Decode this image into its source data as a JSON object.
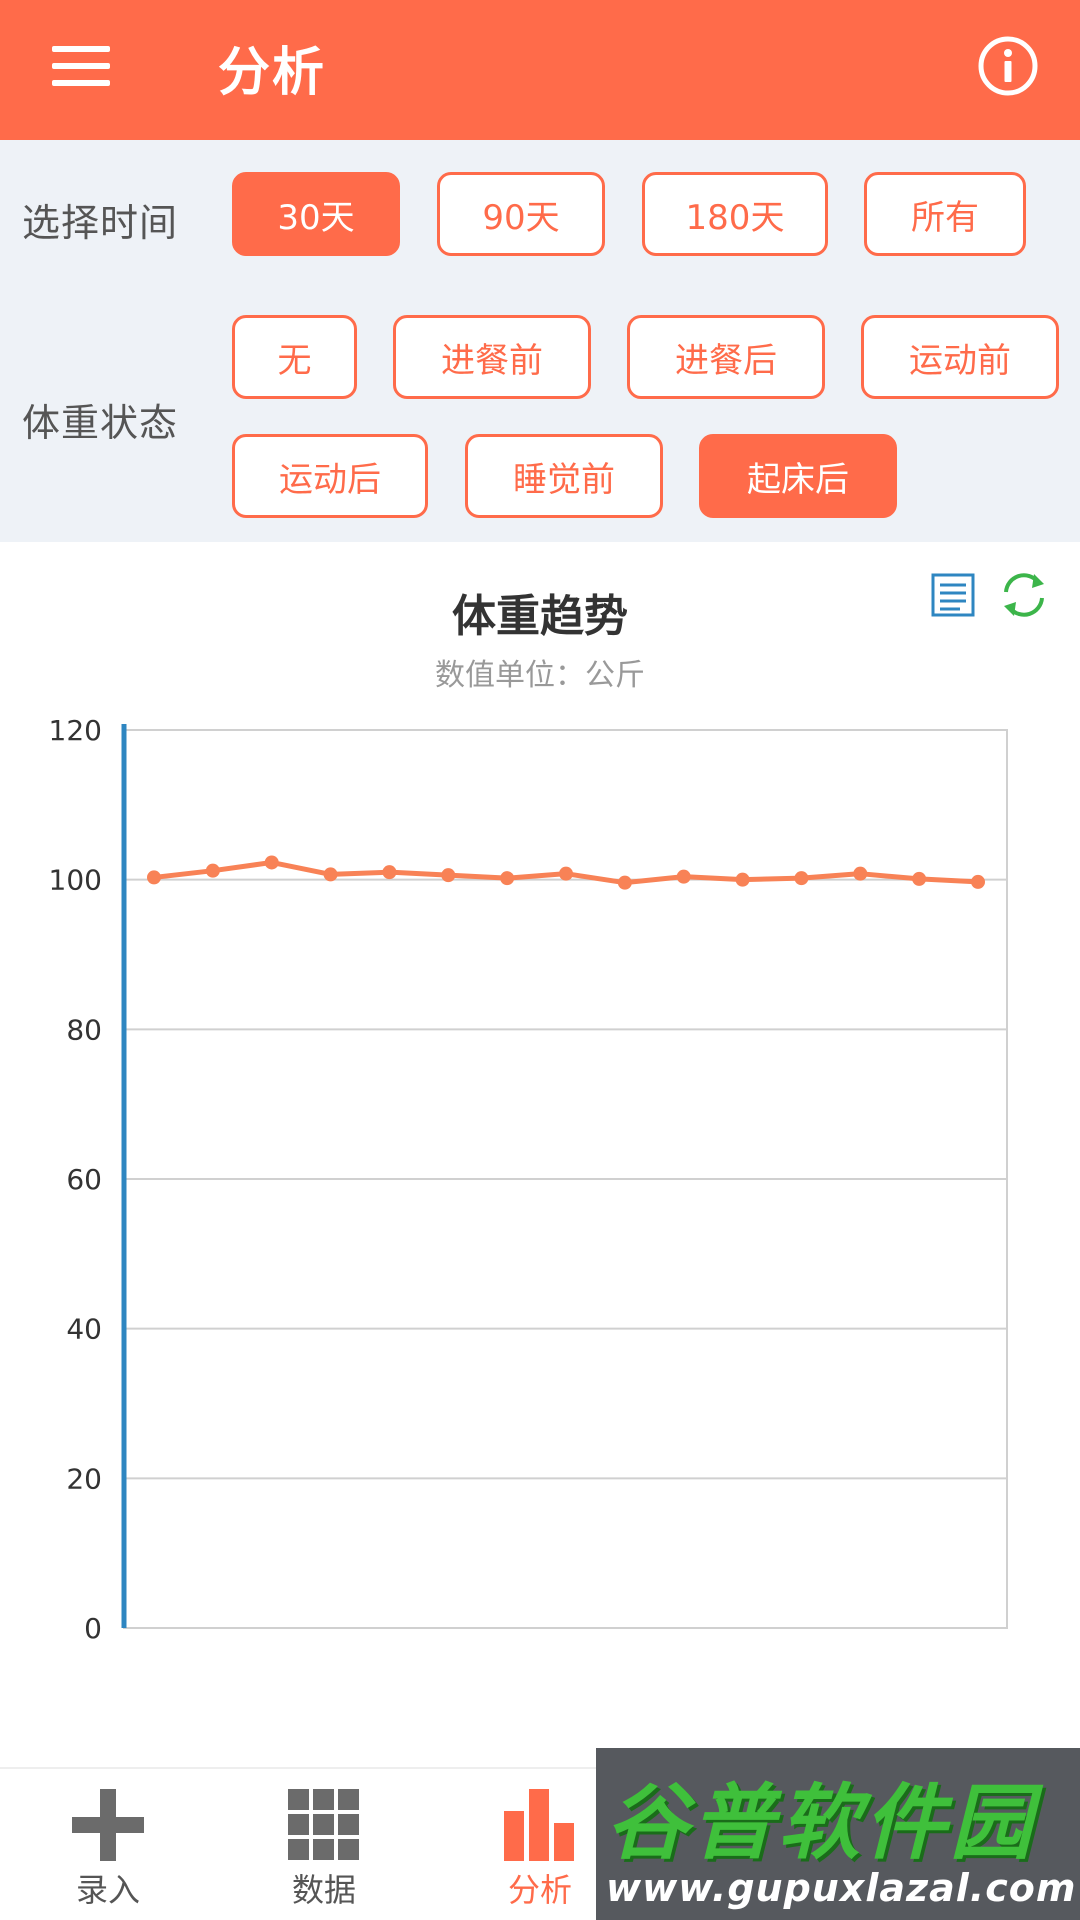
{
  "appbar": {
    "title": "分析"
  },
  "filters": {
    "time_label": "选择时间",
    "time_options": [
      {
        "label": "30天",
        "selected": true
      },
      {
        "label": "90天",
        "selected": false
      },
      {
        "label": "180天",
        "selected": false
      },
      {
        "label": "所有",
        "selected": false
      }
    ],
    "state_label": "体重状态",
    "state_options": [
      {
        "label": "无",
        "selected": false
      },
      {
        "label": "进餐前",
        "selected": false
      },
      {
        "label": "进餐后",
        "selected": false
      },
      {
        "label": "运动前",
        "selected": false
      },
      {
        "label": "运动后",
        "selected": false
      },
      {
        "label": "睡觉前",
        "selected": false
      },
      {
        "label": "起床后",
        "selected": true
      }
    ]
  },
  "chart_data": {
    "type": "line",
    "title": "体重趋势",
    "subtitle": "数值单位：公斤",
    "ylim": [
      0,
      120
    ],
    "yticks": [
      0,
      20,
      40,
      60,
      80,
      100,
      120
    ],
    "grid": true,
    "series": [
      {
        "values": [
          100.3,
          101.2,
          102.3,
          100.7,
          101.0,
          100.6,
          100.2,
          100.8,
          99.6,
          100.4,
          100.0,
          100.2,
          100.8,
          100.1,
          99.7
        ]
      }
    ],
    "colors": {
      "line": "#f88256",
      "axis": "#2e86c1",
      "grid": "#d0d0d0"
    }
  },
  "bottom_nav": {
    "items": [
      {
        "label": "录入",
        "icon": "plus-icon",
        "active": false
      },
      {
        "label": "数据",
        "icon": "grid-icon",
        "active": false
      },
      {
        "label": "分析",
        "icon": "bar-chart-icon",
        "active": true
      }
    ]
  },
  "watermark": {
    "main": "谷普软件园",
    "url": "www.gupuxlazal.com"
  },
  "colors": {
    "accent": "#ff6b4a",
    "filter_bg": "#eef2f7",
    "refresh": "#3cb54a",
    "doc_icon": "#2e86c1"
  }
}
